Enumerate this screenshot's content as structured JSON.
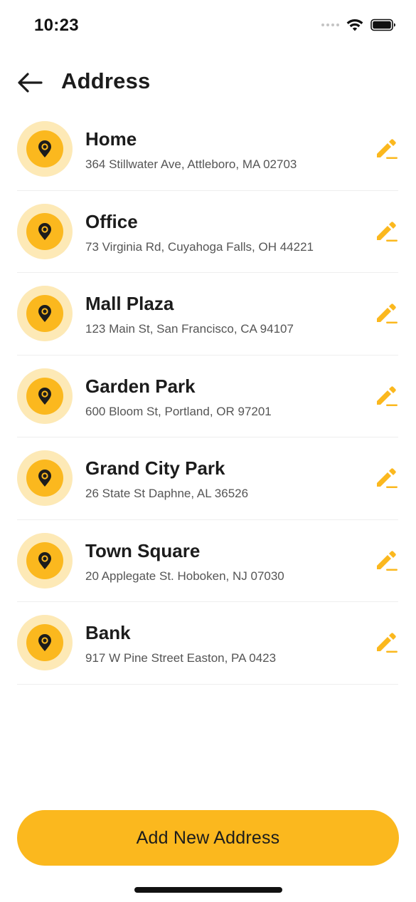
{
  "status_bar": {
    "time": "10:23",
    "icons": [
      "signal-dots-icon",
      "wifi-icon",
      "battery-icon"
    ]
  },
  "header": {
    "back_icon": "back-arrow-icon",
    "title": "Address"
  },
  "colors": {
    "accent": "#fbb81e",
    "accent_light": "#fde9b6",
    "text_primary": "#1c1c1c",
    "text_secondary": "#555555",
    "divider": "#eeeeee"
  },
  "addresses": [
    {
      "name": "Home",
      "address": "364 Stillwater Ave, Attleboro, MA 02703",
      "icon": "location-pin-icon",
      "action_icon": "edit-pencil-icon"
    },
    {
      "name": "Office",
      "address": "73 Virginia Rd, Cuyahoga Falls, OH 44221",
      "icon": "location-pin-icon",
      "action_icon": "edit-pencil-icon"
    },
    {
      "name": "Mall Plaza",
      "address": "123 Main St, San Francisco, CA 94107",
      "icon": "location-pin-icon",
      "action_icon": "edit-pencil-icon"
    },
    {
      "name": "Garden Park",
      "address": "600 Bloom St, Portland, OR 97201",
      "icon": "location-pin-icon",
      "action_icon": "edit-pencil-icon"
    },
    {
      "name": "Grand City Park",
      "address": "26 State St Daphne, AL 36526",
      "icon": "location-pin-icon",
      "action_icon": "edit-pencil-icon"
    },
    {
      "name": "Town Square",
      "address": "20 Applegate St. Hoboken, NJ 07030",
      "icon": "location-pin-icon",
      "action_icon": "edit-pencil-icon"
    },
    {
      "name": "Bank",
      "address": "917 W Pine Street Easton, PA 0423",
      "icon": "location-pin-icon",
      "action_icon": "edit-pencil-icon"
    }
  ],
  "footer": {
    "add_button_label": "Add New Address"
  }
}
